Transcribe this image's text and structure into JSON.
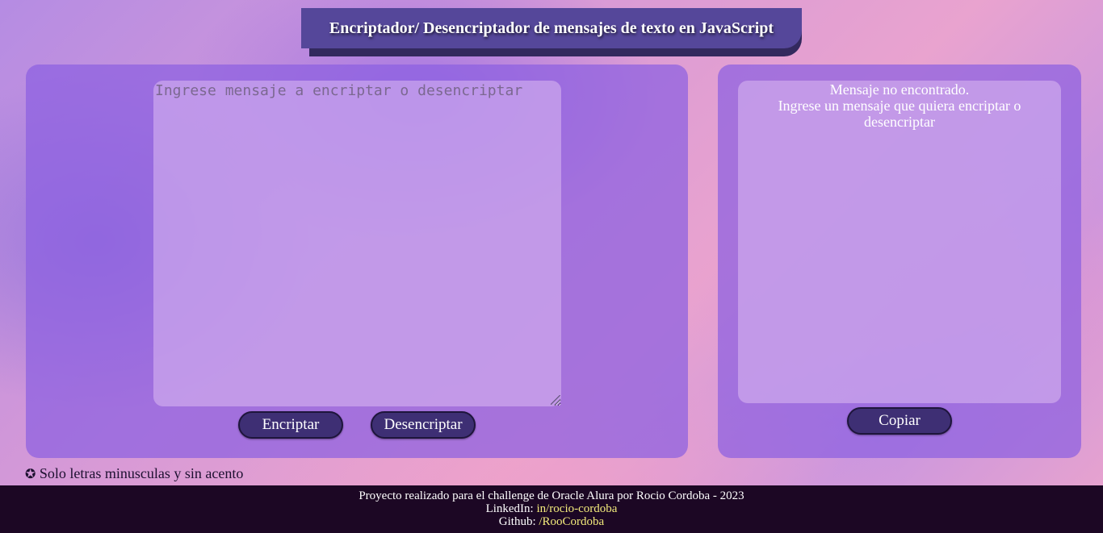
{
  "header": {
    "title": "Encriptador/ Desencriptador de mensajes de texto en JavaScript"
  },
  "input": {
    "placeholder": "Ingrese mensaje a encriptar o desencriptar",
    "value": ""
  },
  "actions": {
    "encrypt_label": "Encriptar",
    "decrypt_label": "Desencriptar",
    "copy_label": "Copiar"
  },
  "output": {
    "line1": "Mensaje no encontrado.",
    "line2": "Ingrese un mensaje que quiera encriptar o desencriptar"
  },
  "note": {
    "icon": "✪",
    "icon_name": "star-circle-icon",
    "text": "Solo letras minusculas y sin acento"
  },
  "footer": {
    "credit": "Proyecto realizado para el challenge de Oracle Alura por Rocio Cordoba - 2023",
    "linkedin_label": "LinkedIn:",
    "linkedin_link": "in/rocio-cordoba",
    "github_label": "Github:",
    "github_link": "/RooCordoba"
  },
  "colors": {
    "button": "#3e2f74",
    "title_bg": "#55479a",
    "footer_bg": "#1c0724",
    "link": "#f3eb7c"
  }
}
